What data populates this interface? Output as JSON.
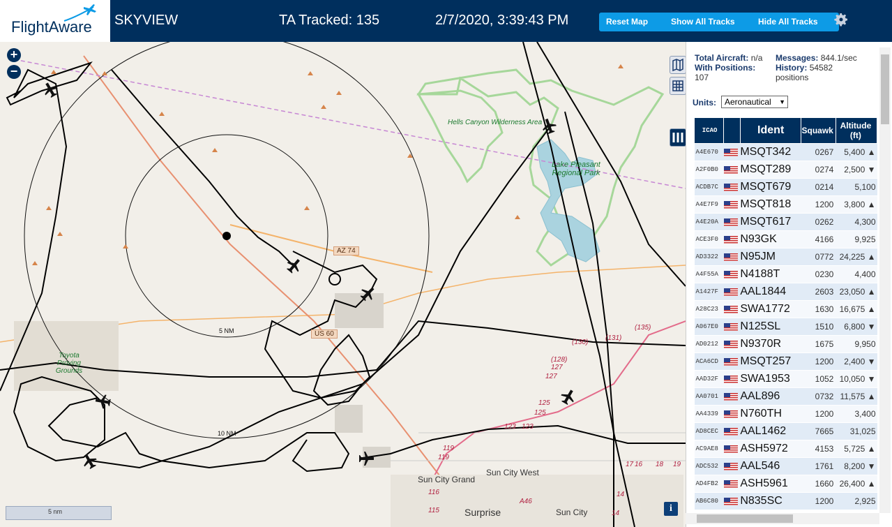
{
  "header": {
    "logo_text": "FlightAware",
    "app_title": "SKYVIEW",
    "tracked": "TA Tracked: 135",
    "clock": "2/7/2020, 3:39:43 PM",
    "buttons": {
      "reset": "Reset Map",
      "show_all": "Show All Tracks",
      "hide_all": "Hide All Tracks"
    },
    "settings_icon": "gear-icon"
  },
  "map": {
    "zoom_in": "+",
    "zoom_out": "−",
    "scale_label": "5 nm",
    "info": "i",
    "labels": {
      "hells_canyon": "Hells Canyon Wilderness Area",
      "lake_pleasant": "Lake Pleasant Regional Park",
      "toyota": "Toyota Proving Grounds",
      "az74": "AZ 74",
      "us60": "US 60",
      "ring5": "5 NM",
      "ring10": "10 NM",
      "sun_city_grand": "Sun City Grand",
      "sun_city_west": "Sun City West",
      "surprise": "Surprise",
      "sun_city": "Sun City",
      "routes": [
        "(135)",
        "(131)",
        "(130)",
        "(128)",
        "127",
        "127",
        "125",
        "125",
        "123",
        "123",
        "119",
        "119",
        "116",
        "115",
        "A46",
        "16",
        "17",
        "18",
        "19",
        "14",
        "14"
      ]
    }
  },
  "panel": {
    "total_aircraft_label": "Total Aircraft:",
    "total_aircraft": "n/a",
    "with_positions_label": "With Positions:",
    "with_positions": "107",
    "messages_label": "Messages:",
    "messages": "844.1/sec",
    "history_label": "History:",
    "history": "54582 positions",
    "units_label": "Units:",
    "units_value": "Aeronautical",
    "columns": {
      "icao": "ICAO",
      "ident": "Ident",
      "squawk": "Squawk",
      "altitude": "Altitude (ft)"
    },
    "rows": [
      {
        "icao": "A4E670",
        "ident": "MSQT342",
        "squawk": "0267",
        "alt": "5,400 ▲"
      },
      {
        "icao": "A2F0B0",
        "ident": "MSQT289",
        "squawk": "0274",
        "alt": "2,500 ▼"
      },
      {
        "icao": "ACDB7C",
        "ident": "MSQT679",
        "squawk": "0214",
        "alt": "5,100"
      },
      {
        "icao": "A4E7F9",
        "ident": "MSQT818",
        "squawk": "1200",
        "alt": "3,800 ▲"
      },
      {
        "icao": "A4E20A",
        "ident": "MSQT617",
        "squawk": "0262",
        "alt": "4,300"
      },
      {
        "icao": "ACE3F0",
        "ident": "N93GK",
        "squawk": "4166",
        "alt": "9,925"
      },
      {
        "icao": "AD3322",
        "ident": "N95JM",
        "squawk": "0772",
        "alt": "24,225 ▲"
      },
      {
        "icao": "A4F55A",
        "ident": "N4188T",
        "squawk": "0230",
        "alt": "4,400"
      },
      {
        "icao": "A1427F",
        "ident": "AAL1844",
        "squawk": "2603",
        "alt": "23,050 ▲"
      },
      {
        "icao": "A28C23",
        "ident": "SWA1772",
        "squawk": "1630",
        "alt": "16,675 ▲"
      },
      {
        "icao": "A067E0",
        "ident": "N125SL",
        "squawk": "1510",
        "alt": "6,800 ▼"
      },
      {
        "icao": "AD0212",
        "ident": "N9370R",
        "squawk": "1675",
        "alt": "9,950"
      },
      {
        "icao": "ACA6CD",
        "ident": "MSQT257",
        "squawk": "1200",
        "alt": "2,400 ▼"
      },
      {
        "icao": "AAD32F",
        "ident": "SWA1953",
        "squawk": "1052",
        "alt": "10,050 ▼"
      },
      {
        "icao": "AA0701",
        "ident": "AAL896",
        "squawk": "0732",
        "alt": "11,575 ▲"
      },
      {
        "icao": "AA4339",
        "ident": "N760TH",
        "squawk": "1200",
        "alt": "3,400"
      },
      {
        "icao": "AD8CEC",
        "ident": "AAL1462",
        "squawk": "7665",
        "alt": "31,025"
      },
      {
        "icao": "AC9AE8",
        "ident": "ASH5972",
        "squawk": "4153",
        "alt": "5,725 ▲"
      },
      {
        "icao": "ADC532",
        "ident": "AAL546",
        "squawk": "1761",
        "alt": "8,200 ▼"
      },
      {
        "icao": "AD4FB2",
        "ident": "ASH5961",
        "squawk": "1660",
        "alt": "26,400 ▲"
      },
      {
        "icao": "AB6C80",
        "ident": "N835SC",
        "squawk": "1200",
        "alt": "2,925"
      }
    ]
  }
}
